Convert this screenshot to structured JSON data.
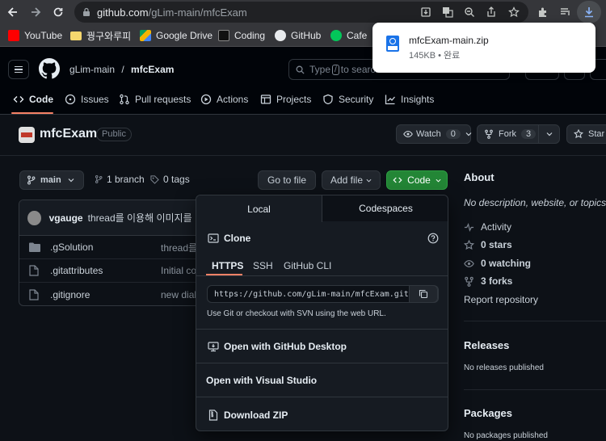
{
  "browser": {
    "url_domain": "github.com",
    "url_path": "/gLim-main/mfcExam",
    "bookmarks": [
      "YouTube",
      "꿩구와루피",
      "Google Drive",
      "Coding",
      "GitHub",
      "Cafe"
    ]
  },
  "download": {
    "filename": "mfcExam-main.zip",
    "info": "145KB • 완료"
  },
  "header": {
    "owner": "gLim-main",
    "separator": "/",
    "repo": "mfcExam",
    "search_placeholder_prefix": "Type",
    "search_key": "/",
    "search_placeholder_suffix": "to search"
  },
  "tabs": [
    "Code",
    "Issues",
    "Pull requests",
    "Actions",
    "Projects",
    "Security",
    "Insights"
  ],
  "repo": {
    "name": "mfcExam",
    "visibility": "Public",
    "watch_label": "Watch",
    "watch_count": "0",
    "fork_label": "Fork",
    "fork_count": "3",
    "star_label": "Star"
  },
  "toolbar": {
    "branch": "main",
    "branches": "1 branch",
    "tags": "0 tags",
    "goto": "Go to file",
    "addfile": "Add file",
    "code": "Code"
  },
  "commit": {
    "author": "vgauge",
    "message": "thread를 이용해 이미지를 나"
  },
  "files": [
    {
      "type": "folder",
      "name": ".gSolution",
      "message": "thread를"
    },
    {
      "type": "file",
      "name": ".gitattributes",
      "message": "Initial co"
    },
    {
      "type": "file",
      "name": ".gitignore",
      "message": "new dialo"
    }
  ],
  "about": {
    "title": "About",
    "description": "No description, website, or topics",
    "activity": "Activity",
    "stars": "0 stars",
    "watching": "0 watching",
    "forks": "3 forks",
    "report": "Report repository",
    "releases_title": "Releases",
    "releases_text": "No releases published",
    "packages_title": "Packages",
    "packages_text": "No packages published"
  },
  "clone": {
    "tab_local": "Local",
    "tab_codespaces": "Codespaces",
    "title": "Clone",
    "protocols": [
      "HTTPS",
      "SSH",
      "GitHub CLI"
    ],
    "url": "https://github.com/gLim-main/mfcExam.git",
    "hint": "Use Git or checkout with SVN using the web URL.",
    "desktop": "Open with GitHub Desktop",
    "vs": "Open with Visual Studio",
    "zip": "Download ZIP"
  },
  "colors": {
    "accent_green": "#238636",
    "bg": "#0d1117",
    "tab_underline": "#f78166"
  }
}
